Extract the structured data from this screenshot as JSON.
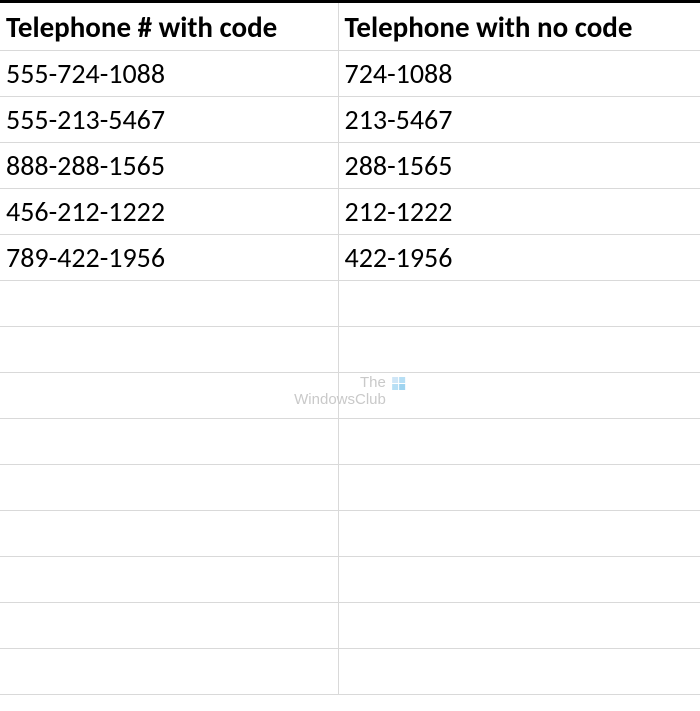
{
  "table": {
    "headers": [
      "Telephone # with code",
      "Telephone with no code"
    ],
    "rows": [
      [
        "555-724-1088",
        "724-1088"
      ],
      [
        "555-213-5467",
        "213-5467"
      ],
      [
        "888-288-1565",
        "288-1565"
      ],
      [
        "456-212-1222",
        "212-1222"
      ],
      [
        "789-422-1956",
        "422-1956"
      ],
      [
        "",
        ""
      ],
      [
        "",
        ""
      ],
      [
        "",
        ""
      ],
      [
        "",
        ""
      ],
      [
        "",
        ""
      ],
      [
        "",
        ""
      ],
      [
        "",
        ""
      ],
      [
        "",
        ""
      ],
      [
        "",
        ""
      ]
    ]
  },
  "watermark": {
    "line1": "The",
    "line2": "WindowsClub"
  }
}
